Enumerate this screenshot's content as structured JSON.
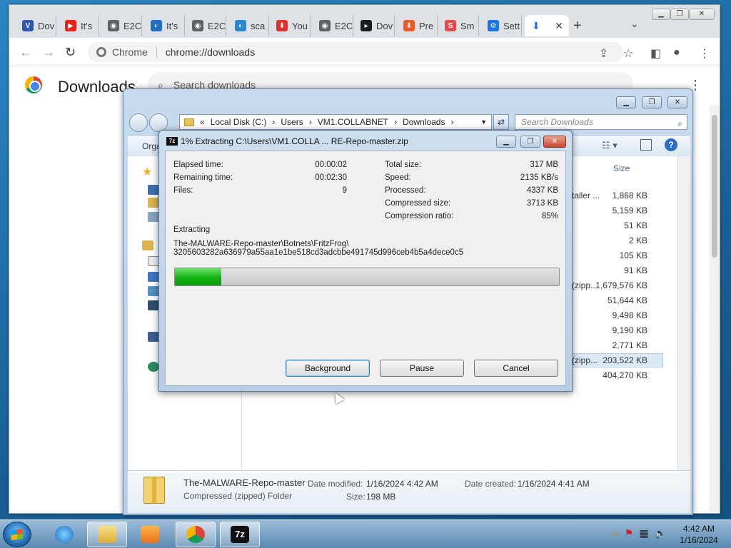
{
  "browser": {
    "tabs": [
      {
        "label": "Dov",
        "color": "#2f57b5",
        "glyph": "V"
      },
      {
        "label": "It's",
        "color": "#e62117",
        "glyph": "▶"
      },
      {
        "label": "E2C",
        "color": "#5f6368",
        "glyph": "◉"
      },
      {
        "label": "It's",
        "color": "#1f6fc3",
        "glyph": "◐"
      },
      {
        "label": "E2C",
        "color": "#5f6368",
        "glyph": "◉"
      },
      {
        "label": "sca",
        "color": "#2a87d0",
        "glyph": "◐"
      },
      {
        "label": "You",
        "color": "#e03131",
        "glyph": "⬇"
      },
      {
        "label": "E2C",
        "color": "#5f6368",
        "glyph": "◉"
      },
      {
        "label": "Dov",
        "color": "#1b1b1b",
        "glyph": "▸"
      },
      {
        "label": "Pre",
        "color": "#f05a28",
        "glyph": "⬇"
      },
      {
        "label": "Sm",
        "color": "#e34c4c",
        "glyph": "S"
      },
      {
        "label": "Sett",
        "color": "#1a73e8",
        "glyph": "⚙"
      }
    ],
    "active_tab_icon": "⬇",
    "new_tab": "+",
    "omnibox_scheme": "Chrome",
    "omnibox_url": "chrome://downloads",
    "page_title": "Downloads",
    "search_placeholder": "Search downloads"
  },
  "explorer": {
    "address": [
      "«",
      "Local Disk (C:)",
      "›",
      "Users",
      "›",
      "VM1.COLLABNET",
      "›",
      "Downloads",
      "›"
    ],
    "search_placeholder": "Search Downloads",
    "organize": "Orga",
    "size_header": "Size",
    "rows": [
      {
        "type": "staller ...",
        "size": "1,868 KB"
      },
      {
        "type": "",
        "size": "5,159 KB"
      },
      {
        "type": "",
        "size": "51 KB"
      },
      {
        "type": "",
        "size": "2 KB"
      },
      {
        "type": "",
        "size": "105 KB"
      },
      {
        "type": "",
        "size": "91 KB"
      },
      {
        "type": "l (zipp...",
        "size": "1,679,576 KB"
      },
      {
        "type": "",
        "size": "51,644 KB"
      },
      {
        "type": "",
        "size": "9,498 KB"
      },
      {
        "type": "",
        "size": "9,190 KB"
      },
      {
        "type": "",
        "size": "2,771 KB"
      },
      {
        "type": "l (zipp...",
        "size": "203,522 KB"
      },
      {
        "type": "",
        "size": "404,270 KB"
      }
    ],
    "details": {
      "name": "The-MALWARE-Repo-master",
      "kind": "Compressed (zipped) Folder",
      "modified_label": "Date modified:",
      "modified": "1/16/2024 4:42 AM",
      "created_label": "Date created:",
      "created": "1/16/2024 4:41 AM",
      "size_label": "Size:",
      "size": "198 MB"
    }
  },
  "sevenzip": {
    "title": "1% Extracting C:\\Users\\VM1.COLLA ... RE-Repo-master.zip",
    "elapsed_label": "Elapsed time:",
    "elapsed": "00:00:02",
    "remaining_label": "Remaining time:",
    "remaining": "00:02:30",
    "files_label": "Files:",
    "files": "9",
    "total_label": "Total size:",
    "total": "317 MB",
    "speed_label": "Speed:",
    "speed": "2135 KB/s",
    "processed_label": "Processed:",
    "processed": "4337 KB",
    "compressed_label": "Compressed size:",
    "compressed": "3713 KB",
    "ratio_label": "Compression ratio:",
    "ratio": "85%",
    "extracting_label": "Extracting",
    "path_line1": "The-MALWARE-Repo-master\\Botnets\\FritzFrog\\",
    "path_line2": "3205603282a636979a55aa1e1be518cd3adcbbe491745d996ceb4b5a4dece0c5",
    "progress": 0.12,
    "buttons": {
      "background": "Background",
      "pause": "Pause",
      "cancel": "Cancel"
    },
    "app_icon": "7z"
  },
  "taskbar": {
    "apps": [
      "ie-icon",
      "explorer-icon",
      "media-player-icon",
      "chrome-icon",
      "7zip-icon"
    ],
    "clock_time": "4:42 AM",
    "clock_date": "1/16/2024"
  }
}
